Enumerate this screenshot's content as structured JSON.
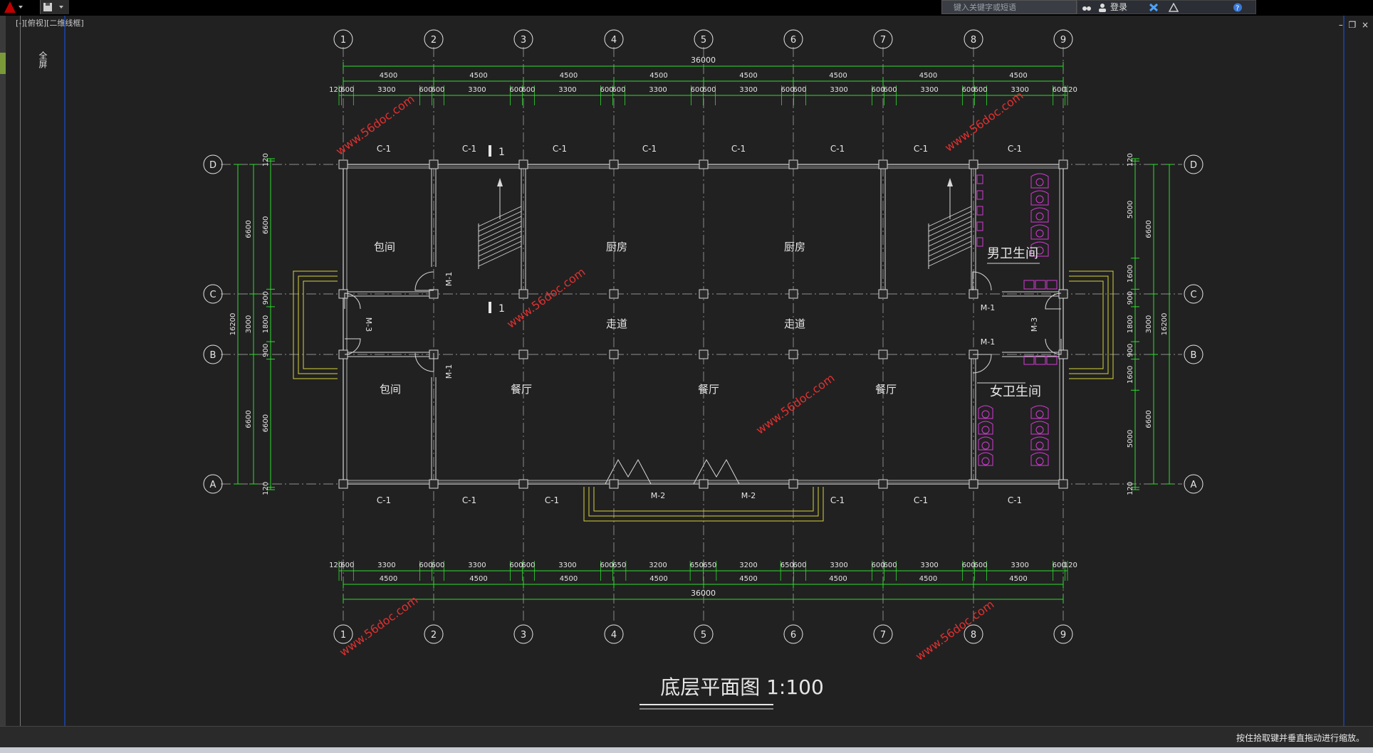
{
  "window": {
    "search_placeholder": "键入关键字或短语",
    "login_label": "登录",
    "viewport_label": "[-][俯视][二维线框]",
    "side_text": "全屏",
    "status_message": "按住拾取键并垂直拖动进行缩放。"
  },
  "drawing": {
    "title": "底层平面图 1:100",
    "axes_x": [
      "1",
      "2",
      "3",
      "4",
      "5",
      "6",
      "7",
      "8",
      "9"
    ],
    "axes_y": [
      "D",
      "C",
      "B",
      "A"
    ],
    "dim_total": "36000",
    "dim_bays": [
      "4500",
      "4500",
      "4500",
      "4500",
      "4500",
      "4500",
      "4500",
      "4500"
    ],
    "dim_detail_top": [
      "120",
      "600",
      "3300",
      "600",
      "600",
      "3300",
      "600",
      "600",
      "3300",
      "600",
      "600",
      "3300",
      "600",
      "600",
      "3300",
      "600",
      "600",
      "3300",
      "600",
      "600",
      "3300",
      "600",
      "600",
      "3300",
      "600",
      "120"
    ],
    "dim_detail_bottom": [
      "120",
      "600",
      "3300",
      "600",
      "600",
      "3300",
      "600",
      "600",
      "3300",
      "600",
      "650",
      "3200",
      "650",
      "650",
      "3200",
      "650",
      "600",
      "3300",
      "600",
      "600",
      "3300",
      "600",
      "600",
      "3300",
      "600",
      "120"
    ],
    "dim_left_outer": [
      "6600",
      "3000",
      "6600"
    ],
    "dim_left_inner": [
      "120",
      "6600",
      "900",
      "1800",
      "900",
      "6600",
      "120"
    ],
    "dim_left_total": "16200",
    "dim_right_inner": [
      "120",
      "5000",
      "1600",
      "900",
      "1800",
      "900",
      "1600",
      "5000",
      "120"
    ],
    "dim_right_outer": [
      "6600",
      "3000",
      "6600"
    ],
    "dim_right_total": "16200",
    "windows_top": [
      "C-1",
      "C-1",
      "C-1",
      "C-1",
      "C-1",
      "C-1",
      "C-1",
      "C-1"
    ],
    "windows_bottom": [
      "C-1",
      "C-1",
      "C-1",
      "C-1",
      "C-1",
      "C-1"
    ],
    "rooms": {
      "private1": "包间",
      "private2": "包间",
      "kitchen1": "厨房",
      "kitchen2": "厨房",
      "corridor1": "走道",
      "corridor2": "走道",
      "dining1": "餐厅",
      "dining2": "餐厅",
      "dining3": "餐厅",
      "men_wc": "男卫生间",
      "women_wc": "女卫生间"
    },
    "doors": {
      "m1a": "M-1",
      "m1b": "M-1",
      "m1c": "M-1",
      "m1d": "M-1",
      "m2a": "M-2",
      "m2b": "M-2",
      "m3a": "M-3",
      "m3b": "M-3"
    },
    "section": {
      "s1": "1",
      "s2": "1"
    },
    "watermark": "www.56doc.com",
    "colors": {
      "bg": "#212121",
      "wall": "#d8d8d8",
      "axis": "#e6e6e6",
      "dim": "#2fdc2f",
      "yellow": "#d7d23a",
      "magenta": "#d43bd4"
    }
  }
}
